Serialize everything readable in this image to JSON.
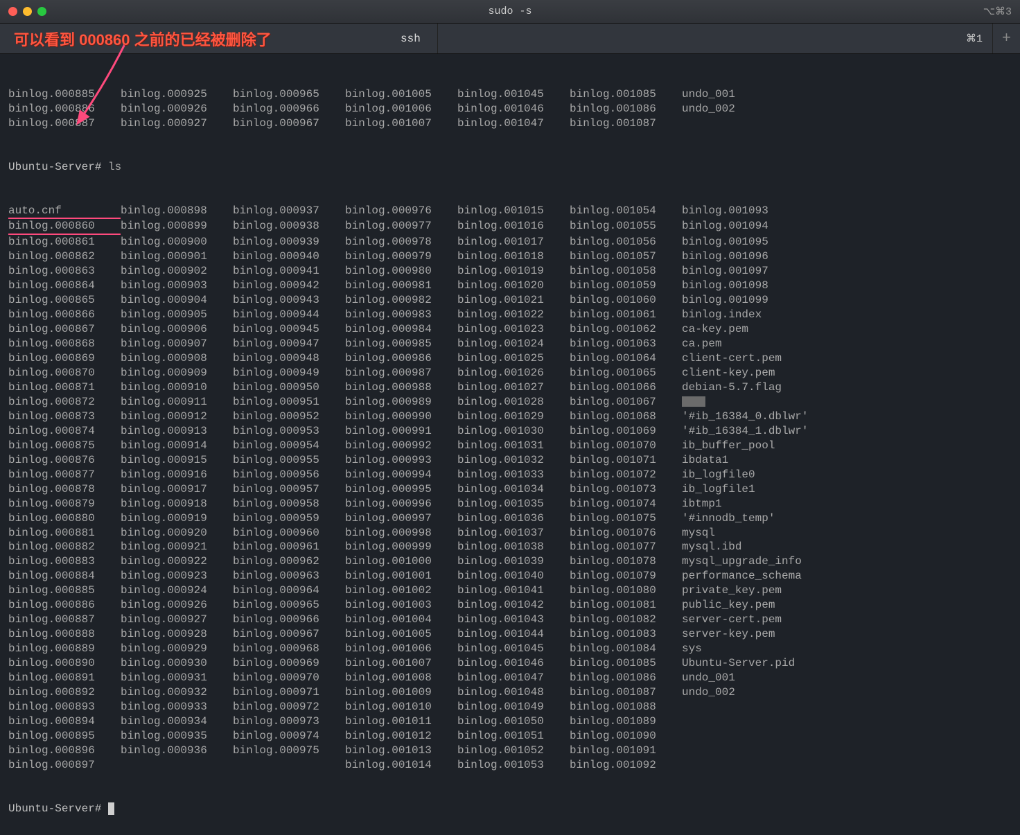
{
  "titlebar": {
    "title": "sudo -s",
    "shortcut_right": "⌥⌘3"
  },
  "tabbar": {
    "tab_label": "ssh",
    "badge": "⌘1",
    "add_label": "+",
    "annotation_text": "可以看到 000860 之前的已经被删除了"
  },
  "prompt": {
    "host": "Ubuntu-Server#",
    "cmd": "ls"
  },
  "top_block": {
    "rows": [
      [
        "binlog.000885",
        "binlog.000925",
        "binlog.000965",
        "binlog.001005",
        "binlog.001045",
        "binlog.001085",
        "undo_001"
      ],
      [
        "binlog.000886",
        "binlog.000926",
        "binlog.000966",
        "binlog.001006",
        "binlog.001046",
        "binlog.001086",
        "undo_002"
      ],
      [
        "binlog.000887",
        "binlog.000927",
        "binlog.000967",
        "binlog.001007",
        "binlog.001047",
        "binlog.001087",
        ""
      ]
    ]
  },
  "listing": {
    "col0": [
      "auto.cnf",
      "binlog.000860",
      "binlog.000861",
      "binlog.000862",
      "binlog.000863",
      "binlog.000864",
      "binlog.000865",
      "binlog.000866",
      "binlog.000867",
      "binlog.000868",
      "binlog.000869",
      "binlog.000870",
      "binlog.000871",
      "binlog.000872",
      "binlog.000873",
      "binlog.000874",
      "binlog.000875",
      "binlog.000876",
      "binlog.000877",
      "binlog.000878",
      "binlog.000879",
      "binlog.000880",
      "binlog.000881",
      "binlog.000882",
      "binlog.000883",
      "binlog.000884",
      "binlog.000885",
      "binlog.000886",
      "binlog.000887",
      "binlog.000888",
      "binlog.000889",
      "binlog.000890",
      "binlog.000891",
      "binlog.000892",
      "binlog.000893",
      "binlog.000894",
      "binlog.000895",
      "binlog.000896",
      "binlog.000897"
    ],
    "col1": [
      "binlog.000898",
      "binlog.000899",
      "binlog.000900",
      "binlog.000901",
      "binlog.000902",
      "binlog.000903",
      "binlog.000904",
      "binlog.000905",
      "binlog.000906",
      "binlog.000907",
      "binlog.000908",
      "binlog.000909",
      "binlog.000910",
      "binlog.000911",
      "binlog.000912",
      "binlog.000913",
      "binlog.000914",
      "binlog.000915",
      "binlog.000916",
      "binlog.000917",
      "binlog.000918",
      "binlog.000919",
      "binlog.000920",
      "binlog.000921",
      "binlog.000922",
      "binlog.000923",
      "binlog.000924",
      "binlog.000926",
      "binlog.000927",
      "binlog.000928",
      "binlog.000929",
      "binlog.000930",
      "binlog.000931",
      "binlog.000932",
      "binlog.000933",
      "binlog.000934",
      "binlog.000935",
      "binlog.000936"
    ],
    "col2": [
      "binlog.000937",
      "binlog.000938",
      "binlog.000939",
      "binlog.000940",
      "binlog.000941",
      "binlog.000942",
      "binlog.000943",
      "binlog.000944",
      "binlog.000945",
      "binlog.000947",
      "binlog.000948",
      "binlog.000949",
      "binlog.000950",
      "binlog.000951",
      "binlog.000952",
      "binlog.000953",
      "binlog.000954",
      "binlog.000955",
      "binlog.000956",
      "binlog.000957",
      "binlog.000958",
      "binlog.000959",
      "binlog.000960",
      "binlog.000961",
      "binlog.000962",
      "binlog.000963",
      "binlog.000964",
      "binlog.000965",
      "binlog.000966",
      "binlog.000967",
      "binlog.000968",
      "binlog.000969",
      "binlog.000970",
      "binlog.000971",
      "binlog.000972",
      "binlog.000973",
      "binlog.000974",
      "binlog.000975"
    ],
    "col3": [
      "binlog.000976",
      "binlog.000977",
      "binlog.000978",
      "binlog.000979",
      "binlog.000980",
      "binlog.000981",
      "binlog.000982",
      "binlog.000983",
      "binlog.000984",
      "binlog.000985",
      "binlog.000986",
      "binlog.000987",
      "binlog.000988",
      "binlog.000989",
      "binlog.000990",
      "binlog.000991",
      "binlog.000992",
      "binlog.000993",
      "binlog.000994",
      "binlog.000995",
      "binlog.000996",
      "binlog.000997",
      "binlog.000998",
      "binlog.000999",
      "binlog.001000",
      "binlog.001001",
      "binlog.001002",
      "binlog.001003",
      "binlog.001004",
      "binlog.001005",
      "binlog.001006",
      "binlog.001007",
      "binlog.001008",
      "binlog.001009",
      "binlog.001010",
      "binlog.001011",
      "binlog.001012",
      "binlog.001013",
      "binlog.001014"
    ],
    "col4": [
      "binlog.001015",
      "binlog.001016",
      "binlog.001017",
      "binlog.001018",
      "binlog.001019",
      "binlog.001020",
      "binlog.001021",
      "binlog.001022",
      "binlog.001023",
      "binlog.001024",
      "binlog.001025",
      "binlog.001026",
      "binlog.001027",
      "binlog.001028",
      "binlog.001029",
      "binlog.001030",
      "binlog.001031",
      "binlog.001032",
      "binlog.001033",
      "binlog.001034",
      "binlog.001035",
      "binlog.001036",
      "binlog.001037",
      "binlog.001038",
      "binlog.001039",
      "binlog.001040",
      "binlog.001041",
      "binlog.001042",
      "binlog.001043",
      "binlog.001044",
      "binlog.001045",
      "binlog.001046",
      "binlog.001047",
      "binlog.001048",
      "binlog.001049",
      "binlog.001050",
      "binlog.001051",
      "binlog.001052",
      "binlog.001053"
    ],
    "col5": [
      "binlog.001054",
      "binlog.001055",
      "binlog.001056",
      "binlog.001057",
      "binlog.001058",
      "binlog.001059",
      "binlog.001060",
      "binlog.001061",
      "binlog.001062",
      "binlog.001063",
      "binlog.001064",
      "binlog.001065",
      "binlog.001066",
      "binlog.001067",
      "binlog.001068",
      "binlog.001069",
      "binlog.001070",
      "binlog.001071",
      "binlog.001072",
      "binlog.001073",
      "binlog.001074",
      "binlog.001075",
      "binlog.001076",
      "binlog.001077",
      "binlog.001078",
      "binlog.001079",
      "binlog.001080",
      "binlog.001081",
      "binlog.001082",
      "binlog.001083",
      "binlog.001084",
      "binlog.001085",
      "binlog.001086",
      "binlog.001087",
      "binlog.001088",
      "binlog.001089",
      "binlog.001090",
      "binlog.001091",
      "binlog.001092"
    ],
    "col6": [
      "binlog.001093",
      "binlog.001094",
      "binlog.001095",
      "binlog.001096",
      "binlog.001097",
      "binlog.001098",
      "binlog.001099",
      "binlog.index",
      "ca-key.pem",
      "ca.pem",
      "client-cert.pem",
      "client-key.pem",
      "debian-5.7.flag",
      "__REDACT__",
      "'#ib_16384_0.dblwr'",
      "'#ib_16384_1.dblwr'",
      "ib_buffer_pool",
      "ibdata1",
      "ib_logfile0",
      "ib_logfile1",
      "ibtmp1",
      "'#innodb_temp'",
      "mysql",
      "mysql.ibd",
      "mysql_upgrade_info",
      "performance_schema",
      "private_key.pem",
      "public_key.pem",
      "server-cert.pem",
      "server-key.pem",
      "sys",
      "Ubuntu-Server.pid",
      "undo_001",
      "undo_002"
    ]
  }
}
